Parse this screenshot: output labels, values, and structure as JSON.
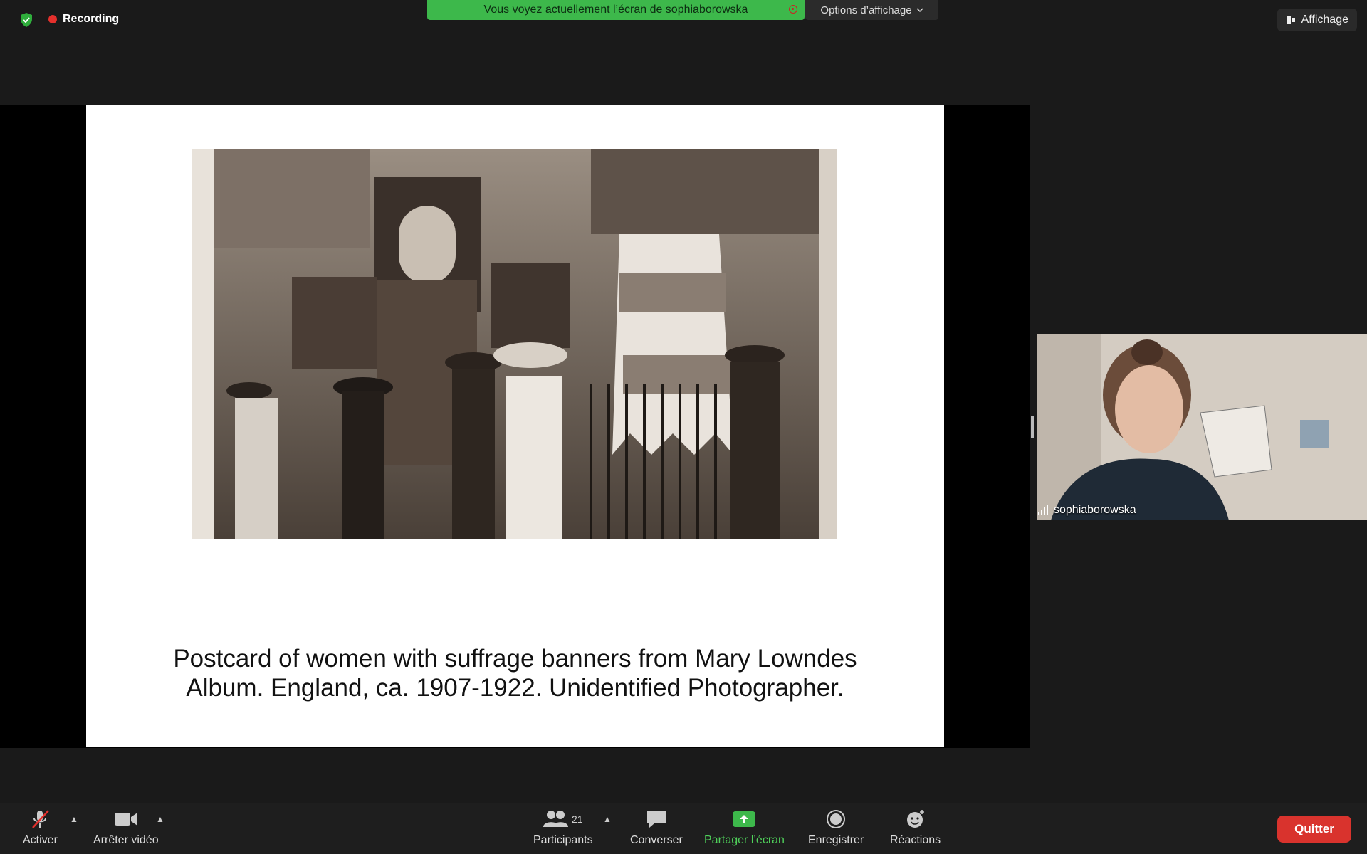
{
  "top_bar": {
    "recording_label": "Recording",
    "banner_text": "Vous voyez actuellement l’écran de sophiaborowska",
    "options_label": "Options d’affichage",
    "view_label": "Affichage"
  },
  "slide": {
    "caption_line1": "Postcard of women with suffrage banners from Mary Lowndes",
    "caption_line2": "Album. England, ca. 1907-1922. Unidentified Photographer."
  },
  "participant": {
    "name": "sophiaborowska"
  },
  "toolbar": {
    "mute_label": "Activer",
    "video_label": "Arrêter vidéo",
    "participants_label": "Participants",
    "participants_count": "21",
    "chat_label": "Converser",
    "share_label": "Partager l’écran",
    "record_label": "Enregistrer",
    "reactions_label": "Réactions",
    "quit_label": "Quitter"
  },
  "colors": {
    "accent_green": "#3db84b",
    "record_red": "#e5302c",
    "quit_red": "#d9332d"
  },
  "icons": [
    "shield-icon",
    "record-dot-icon",
    "chevron-down-icon",
    "view-icon",
    "close-icon",
    "signal-icon",
    "mic-muted-icon",
    "video-icon",
    "participants-icon",
    "chat-icon",
    "share-screen-icon",
    "record-icon",
    "reactions-icon"
  ]
}
